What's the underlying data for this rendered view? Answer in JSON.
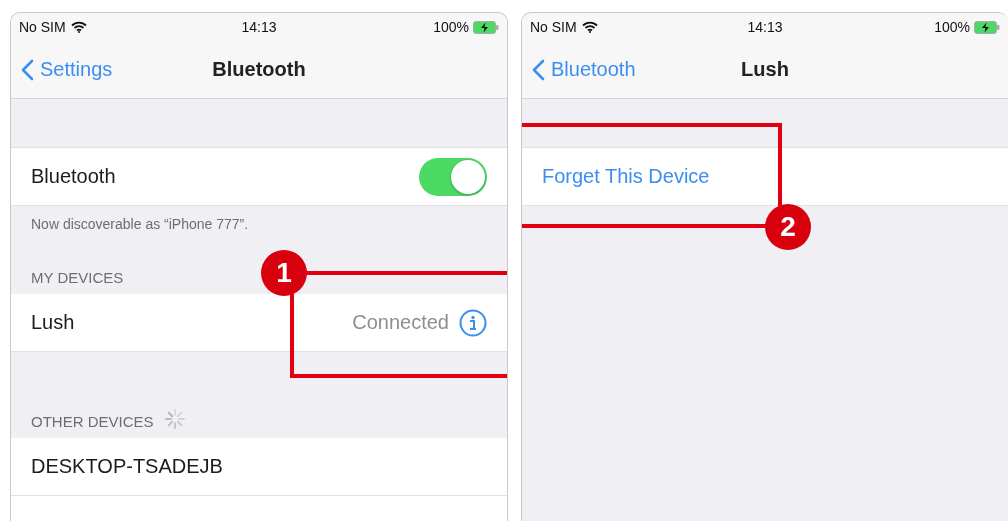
{
  "screens": [
    {
      "status_bar": {
        "carrier": "No SIM",
        "time": "14:13",
        "battery": "100%"
      },
      "nav": {
        "back": "Settings",
        "title": "Bluetooth"
      },
      "sections": [
        {
          "items": [
            {
              "kind": "toggle",
              "label": "Bluetooth",
              "on": true
            }
          ],
          "footer": "Now discoverable as “iPhone 777”."
        },
        {
          "header": "MY DEVICES",
          "items": [
            {
              "kind": "info",
              "label": "Lush",
              "status": "Connected"
            }
          ]
        },
        {
          "header": "OTHER DEVICES",
          "loading": true,
          "items": [
            {
              "kind": "plain",
              "label": "DESKTOP-TSADEJB"
            },
            {
              "kind": "partial"
            }
          ]
        }
      ],
      "annotations": [
        {
          "number": "1"
        }
      ]
    },
    {
      "status_bar": {
        "carrier": "No SIM",
        "time": "14:13",
        "battery": "100%"
      },
      "nav": {
        "back": "Bluetooth",
        "title": "Lush"
      },
      "sections": [
        {
          "items": [
            {
              "kind": "action",
              "label": "Forget This Device"
            }
          ]
        }
      ],
      "annotations": [
        {
          "number": "2"
        }
      ]
    }
  ]
}
